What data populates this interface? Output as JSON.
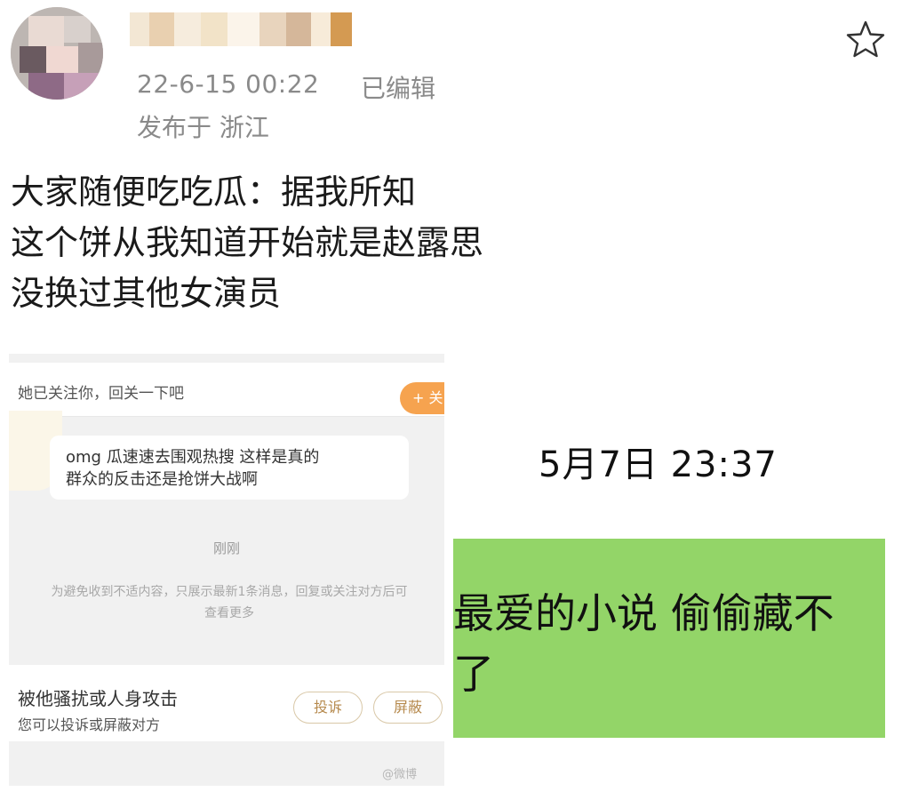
{
  "post": {
    "timestamp": "22-6-15 00:22",
    "edited": "已编辑",
    "location": "发布于 浙江",
    "lines": [
      "大家随便吃吃瓜：据我所知",
      "这个饼从我知道开始就是赵露思",
      "没换过其他女演员"
    ]
  },
  "left_screenshot": {
    "header_text": "她已关注你，回关一下吧",
    "follow_button": "+ 关",
    "message_line1": "omg 瓜速速去围观热搜 这样是真的",
    "message_line2": "群众的反击还是抢饼大战啊",
    "time_label": "刚刚",
    "notice_line1": "为避免收到不适内容，只展示最新1条消息，回复或关注对方后可",
    "notice_line2": "查看更多",
    "harass_title": "被他骚扰或人身攻击",
    "harass_subtitle": "您可以投诉或屏蔽对方",
    "complain_button": "投诉",
    "block_button": "屏蔽",
    "watermark": "@微博"
  },
  "right_screenshot": {
    "time": "5月7日 23:37",
    "text_line1": "最爱的小说 偷偷藏不",
    "text_line2": "了"
  },
  "colors": {
    "meta_gray": "#8a8a8a",
    "follow_orange": "#f6a34f",
    "message_green": "#93d568"
  }
}
